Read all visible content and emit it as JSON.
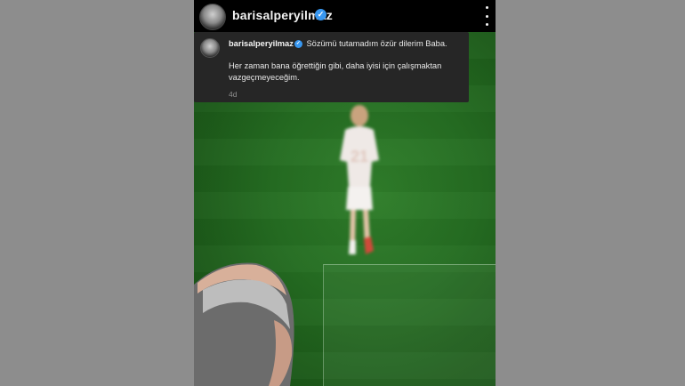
{
  "header": {
    "username": "barisalperyilmaz",
    "verified_glyph": "✓",
    "more_icon": "more-vertical-icon"
  },
  "comment": {
    "username": "barisalperyilmaz",
    "verified_glyph": "✓",
    "first_line": "Sözümü tutamadım özür dilerim Baba.",
    "body": "Her zaman bana öğrettiğin gibi, daha iyisi için çalışmaktan vazgeçmeyeceğim.",
    "time": "4d"
  },
  "colors": {
    "background": "#000000",
    "card": "#262626",
    "verified_blue": "#3897f0",
    "pitch_green": "#256d22"
  }
}
